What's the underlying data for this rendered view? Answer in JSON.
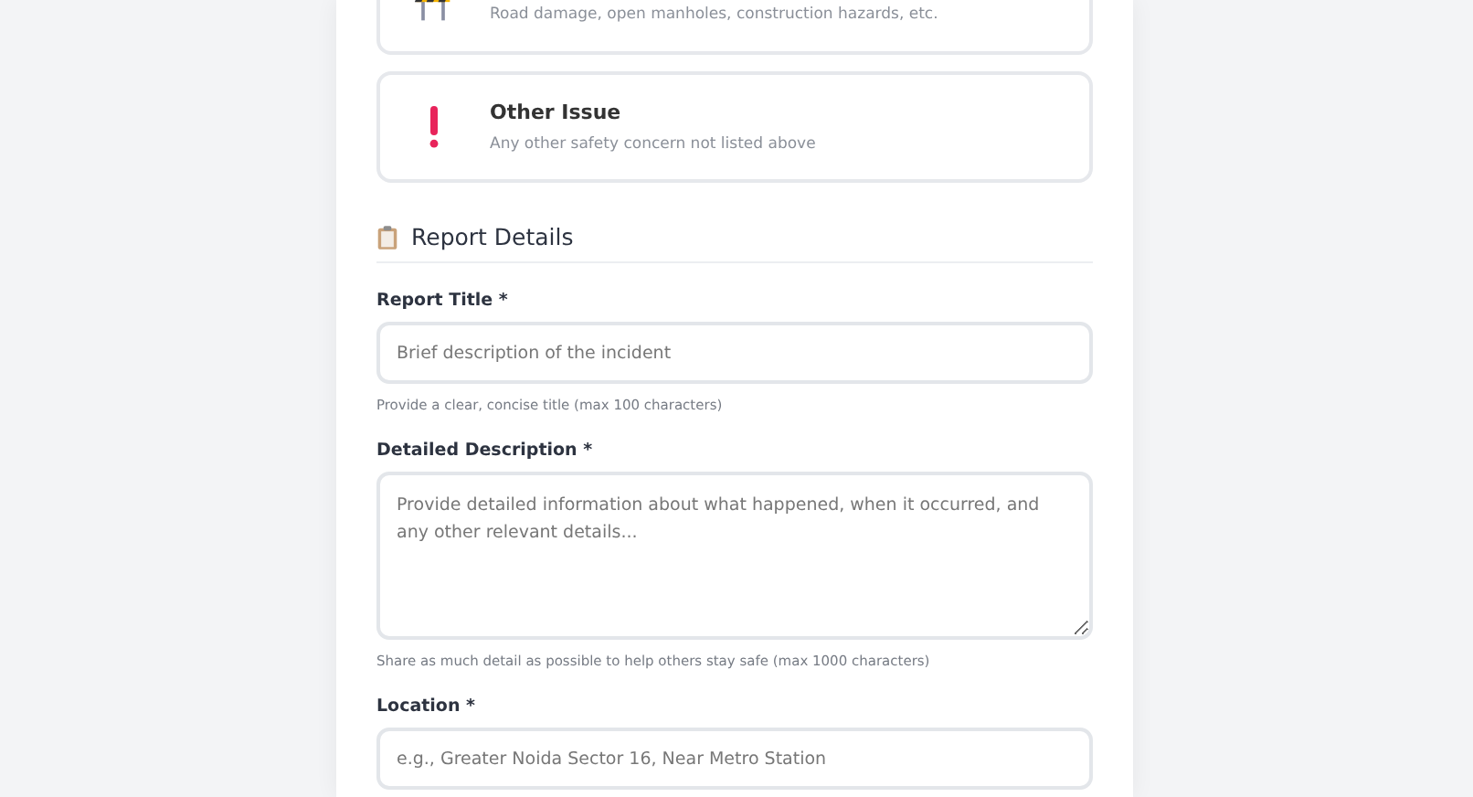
{
  "categories": [
    {
      "kind": "barrier",
      "description": "Road damage, open manholes, construction hazards, etc."
    },
    {
      "kind": "alert",
      "title": "Other Issue",
      "description": "Any other safety concern not listed above"
    }
  ],
  "section": {
    "title": "Report Details"
  },
  "fields": [
    {
      "kind": "input",
      "label": "Report Title *",
      "placeholder": "Brief description of the incident",
      "hint": "Provide a clear, concise title (max 100 characters)"
    },
    {
      "kind": "textarea",
      "label": "Detailed Description *",
      "placeholder": "Provide detailed information about what happened, when it occurred, and any other relevant details...",
      "hint": "Share as much detail as possible to help others stay safe (max 1000 characters)"
    },
    {
      "kind": "input",
      "label": "Location *",
      "placeholder": "e.g., Greater Noida Sector 16, Near Metro Station"
    }
  ]
}
